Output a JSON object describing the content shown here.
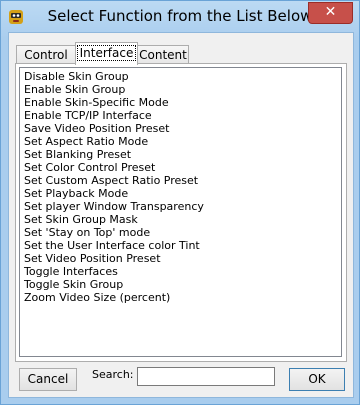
{
  "window": {
    "title": "Select Function from the List Below",
    "close_glyph": "✕",
    "app_icon": "app-logo-icon",
    "accent_color": "#c7504a"
  },
  "tabs": [
    {
      "label": "Control",
      "active": false
    },
    {
      "label": "Interface",
      "active": true
    },
    {
      "label": "Content",
      "active": false
    }
  ],
  "list": {
    "items": [
      "Disable Skin Group",
      "Enable Skin Group",
      "Enable Skin-Specific Mode",
      "Enable TCP/IP Interface",
      "Save Video Position Preset",
      "Set Aspect Ratio Mode",
      "Set Blanking Preset",
      "Set Color Control Preset",
      "Set Custom Aspect Ratio Preset",
      "Set Playback Mode",
      "Set player Window Transparency",
      "Set Skin Group Mask",
      "Set 'Stay on Top' mode",
      "Set the User Interface color Tint",
      "Set Video Position Preset",
      "Toggle Interfaces",
      "Toggle Skin Group",
      "Zoom Video Size (percent)"
    ]
  },
  "footer": {
    "cancel_label": "Cancel",
    "search_label": "Search:",
    "search_value": "",
    "ok_label": "OK"
  }
}
